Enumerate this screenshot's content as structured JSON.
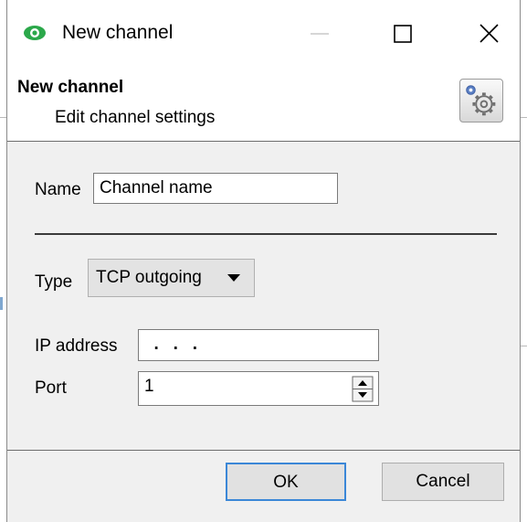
{
  "window": {
    "title": "New channel",
    "minimize_icon": "minimize-icon",
    "maximize_icon": "maximize-icon",
    "close_icon": "close-icon"
  },
  "header": {
    "title": "New channel",
    "subtitle": "Edit channel settings",
    "icon": "settings-gears-icon"
  },
  "form": {
    "name_label": "Name",
    "name_value": "Channel name",
    "type_label": "Type",
    "type_value": "TCP outgoing",
    "ip_label": "IP address",
    "ip_value": "  .   .   .",
    "port_label": "Port",
    "port_value": "1"
  },
  "buttons": {
    "ok_label": "OK",
    "cancel_label": "Cancel"
  },
  "colors": {
    "dialog_bg": "#f0f0f0",
    "focus_border": "#3b87d7",
    "app_icon": "#2ba84a"
  }
}
